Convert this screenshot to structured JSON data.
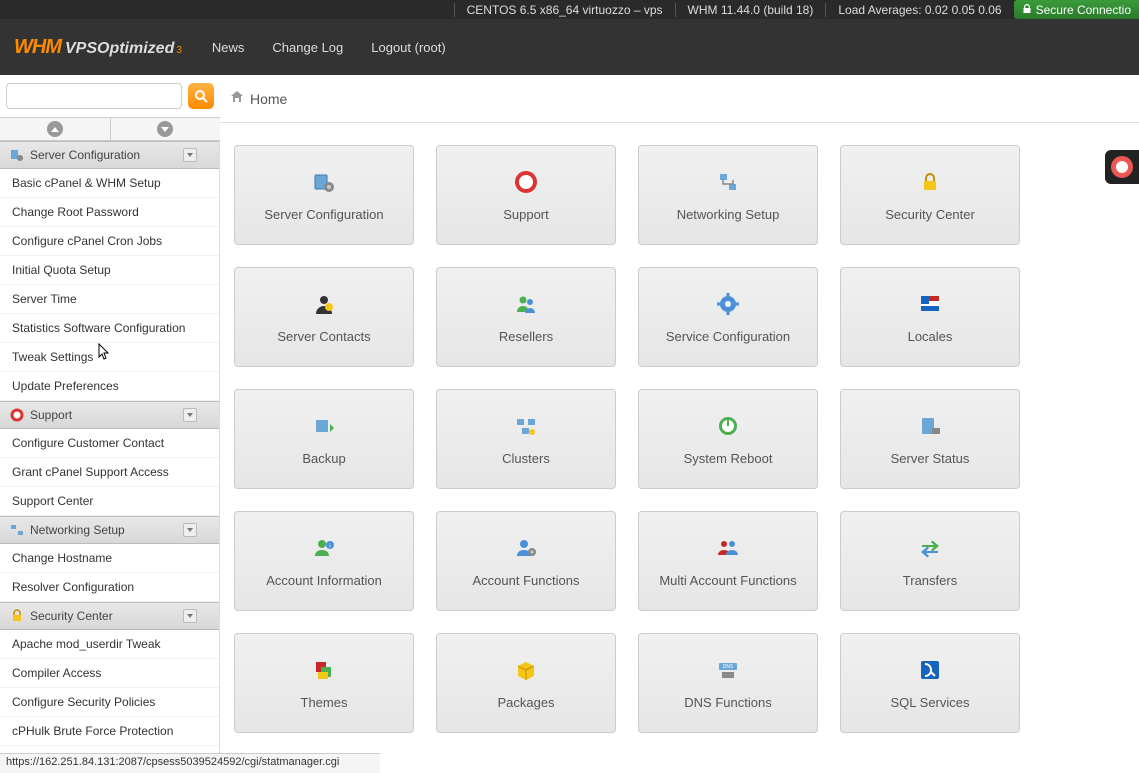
{
  "topbar": {
    "os_info": "CENTOS 6.5 x86_64 virtuozzo – vps",
    "whm_version": "WHM 11.44.0 (build 18)",
    "load_avg": "Load Averages: 0.02 0.05 0.06",
    "secure": "Secure Connectio"
  },
  "header": {
    "logo_whm": "WHM",
    "logo_vps": "VPS ",
    "logo_opt": "Optimized",
    "logo_sub": "3",
    "nav": [
      "News",
      "Change Log",
      "Logout (root)"
    ]
  },
  "breadcrumb": {
    "home": "Home"
  },
  "sidebar": {
    "categories": [
      {
        "title": "Server Configuration",
        "icon": "server-gear",
        "items": [
          "Basic cPanel & WHM Setup",
          "Change Root Password",
          "Configure cPanel Cron Jobs",
          "Initial Quota Setup",
          "Server Time",
          "Statistics Software Configuration",
          "Tweak Settings",
          "Update Preferences"
        ]
      },
      {
        "title": "Support",
        "icon": "lifering",
        "items": [
          "Configure Customer Contact",
          "Grant cPanel Support Access",
          "Support Center"
        ]
      },
      {
        "title": "Networking Setup",
        "icon": "network",
        "items": [
          "Change Hostname",
          "Resolver Configuration"
        ]
      },
      {
        "title": "Security Center",
        "icon": "lock",
        "items": [
          "Apache mod_userdir Tweak",
          "Compiler Access",
          "Configure Security Policies",
          "cPHulk Brute Force Protection"
        ]
      }
    ]
  },
  "tiles": [
    {
      "label": "Server Configuration",
      "icon": "server-gear"
    },
    {
      "label": "Support",
      "icon": "lifering"
    },
    {
      "label": "Networking Setup",
      "icon": "network"
    },
    {
      "label": "Security Center",
      "icon": "lock"
    },
    {
      "label": "Server Contacts",
      "icon": "contact"
    },
    {
      "label": "Resellers",
      "icon": "resellers"
    },
    {
      "label": "Service Configuration",
      "icon": "gear"
    },
    {
      "label": "Locales",
      "icon": "flag"
    },
    {
      "label": "Backup",
      "icon": "backup"
    },
    {
      "label": "Clusters",
      "icon": "clusters"
    },
    {
      "label": "System Reboot",
      "icon": "power"
    },
    {
      "label": "Server Status",
      "icon": "status"
    },
    {
      "label": "Account Information",
      "icon": "accinfo"
    },
    {
      "label": "Account Functions",
      "icon": "accfunc"
    },
    {
      "label": "Multi Account Functions",
      "icon": "multiacc"
    },
    {
      "label": "Transfers",
      "icon": "transfers"
    },
    {
      "label": "Themes",
      "icon": "themes"
    },
    {
      "label": "Packages",
      "icon": "packages"
    },
    {
      "label": "DNS Functions",
      "icon": "dns"
    },
    {
      "label": "SQL Services",
      "icon": "sql"
    }
  ],
  "statusbar": "https://162.251.84.131:2087/cpsess5039524592/cgi/statmanager.cgi"
}
